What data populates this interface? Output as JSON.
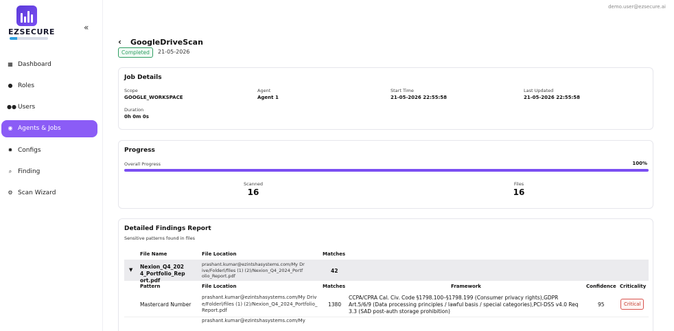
{
  "brand": {
    "name": "EZSECURE",
    "accent": "#8b5cf6"
  },
  "user": {
    "email": "demo.user@ezsecure.ai"
  },
  "sidebar": {
    "collapse_icon": "double-chevron-left",
    "items": [
      {
        "label": "Dashboard",
        "icon": "grid-icon",
        "active": false
      },
      {
        "label": "Roles",
        "icon": "user-gear-icon",
        "active": false
      },
      {
        "label": "Users",
        "icon": "users-icon",
        "active": false
      },
      {
        "label": "Agents & Jobs",
        "icon": "robot-icon",
        "active": true
      },
      {
        "label": "Configs",
        "icon": "gears-icon",
        "active": false
      },
      {
        "label": "Finding",
        "icon": "search-icon",
        "active": false
      },
      {
        "label": "Scan Wizard",
        "icon": "wizard-icon",
        "active": false
      }
    ]
  },
  "header": {
    "title": "GoogleDriveScan",
    "status": "Completed",
    "date": "21-05-2026"
  },
  "job_details": {
    "title": "Job Details",
    "scope_label": "Scope",
    "scope_value": "GOOGLE_WORKSPACE",
    "agent_label": "Agent",
    "agent_value": "Agent 1",
    "start_label": "Start Time",
    "start_value": "21-05-2026 22:55:58",
    "updated_label": "Last Updated",
    "updated_value": "21-05-2026 22:55:58",
    "duration_label": "Duration",
    "duration_value": "0h 0m 0s"
  },
  "progress": {
    "title": "Progress",
    "overall_label": "Overall Progress",
    "percent_text": "100%",
    "fraction": 1.0,
    "scanned_label": "Scanned",
    "scanned_value": "16",
    "files_label": "Files",
    "files_value": "16"
  },
  "findings": {
    "title": "Detailed Findings Report",
    "subtitle": "Sensitive patterns found in files",
    "columns": {
      "file_name": "File Name",
      "file_location": "File Location",
      "matches": "Matches"
    },
    "file": {
      "caret": "▼",
      "name": "Nexion_Q4_2024_Portfolio_Report.pdf",
      "location": "prashant.kumar@ezintshasystems.com/My Drive/Folderl/files (1) (2)/Nexion_Q4_2024_Portfolio_Report.pdf",
      "matches": "42"
    },
    "sub_columns": {
      "pattern": "Pattern",
      "file_location": "File Location",
      "matches": "Matches",
      "framework": "Framework",
      "confidence": "Confidence",
      "criticality": "Criticality"
    },
    "row": {
      "pattern": "Mastercard Number",
      "location": "prashant.kumar@ezintshasystems.com/My Drive/Folderl/files (1) (2)/Nexion_Q4_2024_Portfolio_Report.pdf",
      "matches": "1380",
      "framework": "CCPA/CPRA Cal. Civ. Code §1798.100–§1798.199 (Consumer privacy rights),GDPR Art.5/6/9 (Data processing principles / lawful basis / special categories),PCI-DSS v4.0 Req 3.3 (SAD post-auth storage prohibition)",
      "confidence": "95",
      "criticality": "Critical"
    },
    "next_row_location": "prashant.kumar@ezintshasystems.com/My"
  }
}
